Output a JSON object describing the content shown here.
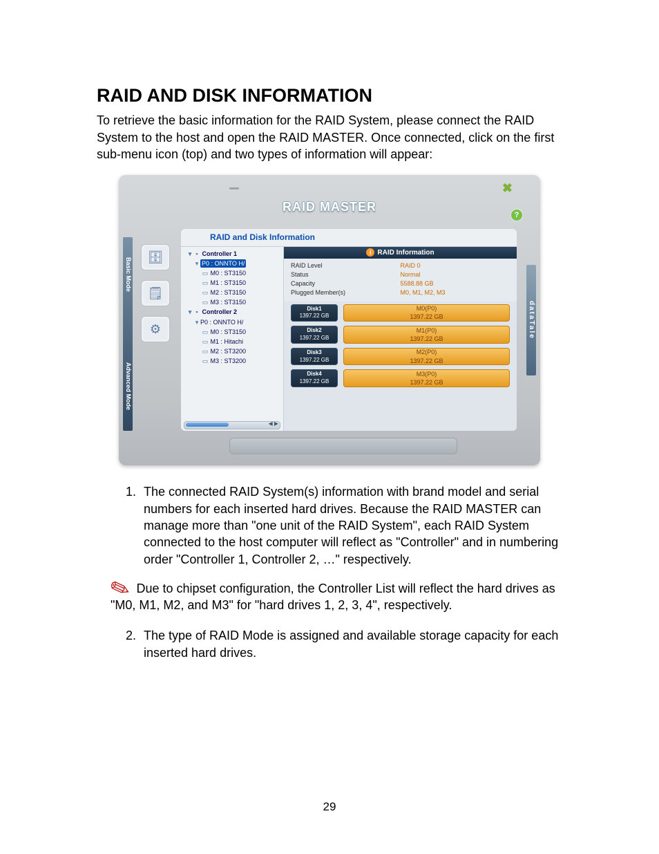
{
  "heading": "RAID AND DISK INFORMATION",
  "intro": "To retrieve the basic information for the RAID System, please connect the RAID System to the host and open the RAID MASTER.  Once connected, click on the first sub-menu icon (top) and two types of information will appear:",
  "shot": {
    "app_title": "RAID MASTER",
    "panel_title": "RAID and Disk Information",
    "help_label": "?",
    "modes": {
      "basic": "Basic Mode",
      "advanced": "Advanced Mode"
    },
    "brand": "dataTale",
    "tree": {
      "controllers": [
        {
          "name": "Controller 1",
          "port": "P0 : ONNTO H/",
          "selected": true,
          "disks": [
            "M0 : ST3150",
            "M1 : ST3150",
            "M2 : ST3150",
            "M3 : ST3150"
          ]
        },
        {
          "name": "Controller 2",
          "port": "P0 : ONNTO H/",
          "selected": false,
          "disks": [
            "M0 : ST3150",
            "M1 : Hitachi",
            "M2 : ST3200",
            "M3 : ST3200"
          ]
        }
      ]
    },
    "info": {
      "header": "RAID Information",
      "rows": [
        {
          "k": "RAID Level",
          "v": "RAID 0"
        },
        {
          "k": "Status",
          "v": "Normal"
        },
        {
          "k": "Capacity",
          "v": "5588.88 GB"
        },
        {
          "k": "Plugged Member(s)",
          "v": "M0, M1, M2, M3"
        }
      ],
      "disks": [
        {
          "label": "Disk1",
          "size": "1397.22 GB",
          "member": "M0(P0)",
          "msize": "1397.22 GB"
        },
        {
          "label": "Disk2",
          "size": "1397.22 GB",
          "member": "M1(P0)",
          "msize": "1397.22 GB"
        },
        {
          "label": "Disk3",
          "size": "1397.22 GB",
          "member": "M2(P0)",
          "msize": "1397.22 GB"
        },
        {
          "label": "Disk4",
          "size": "1397.22 GB",
          "member": "M3(P0)",
          "msize": "1397.22 GB"
        }
      ]
    }
  },
  "list": {
    "item1": "The connected RAID System(s) information with brand model and serial numbers for each inserted hard drives. Because the RAID MASTER can manage more than \"one unit of the RAID System\", each RAID System connected to the host computer will reflect as \"Controller\" and in numbering order \"Controller 1, Controller 2, …\" respectively.",
    "item2": "The type of RAID Mode is assigned and available storage capacity for each inserted hard drives."
  },
  "note": " Due to chipset configuration, the Controller List will reflect the hard drives as \"M0, M1, M2, and M3\" for \"hard drives 1, 2, 3, 4\", respectively.",
  "page_number": "29"
}
